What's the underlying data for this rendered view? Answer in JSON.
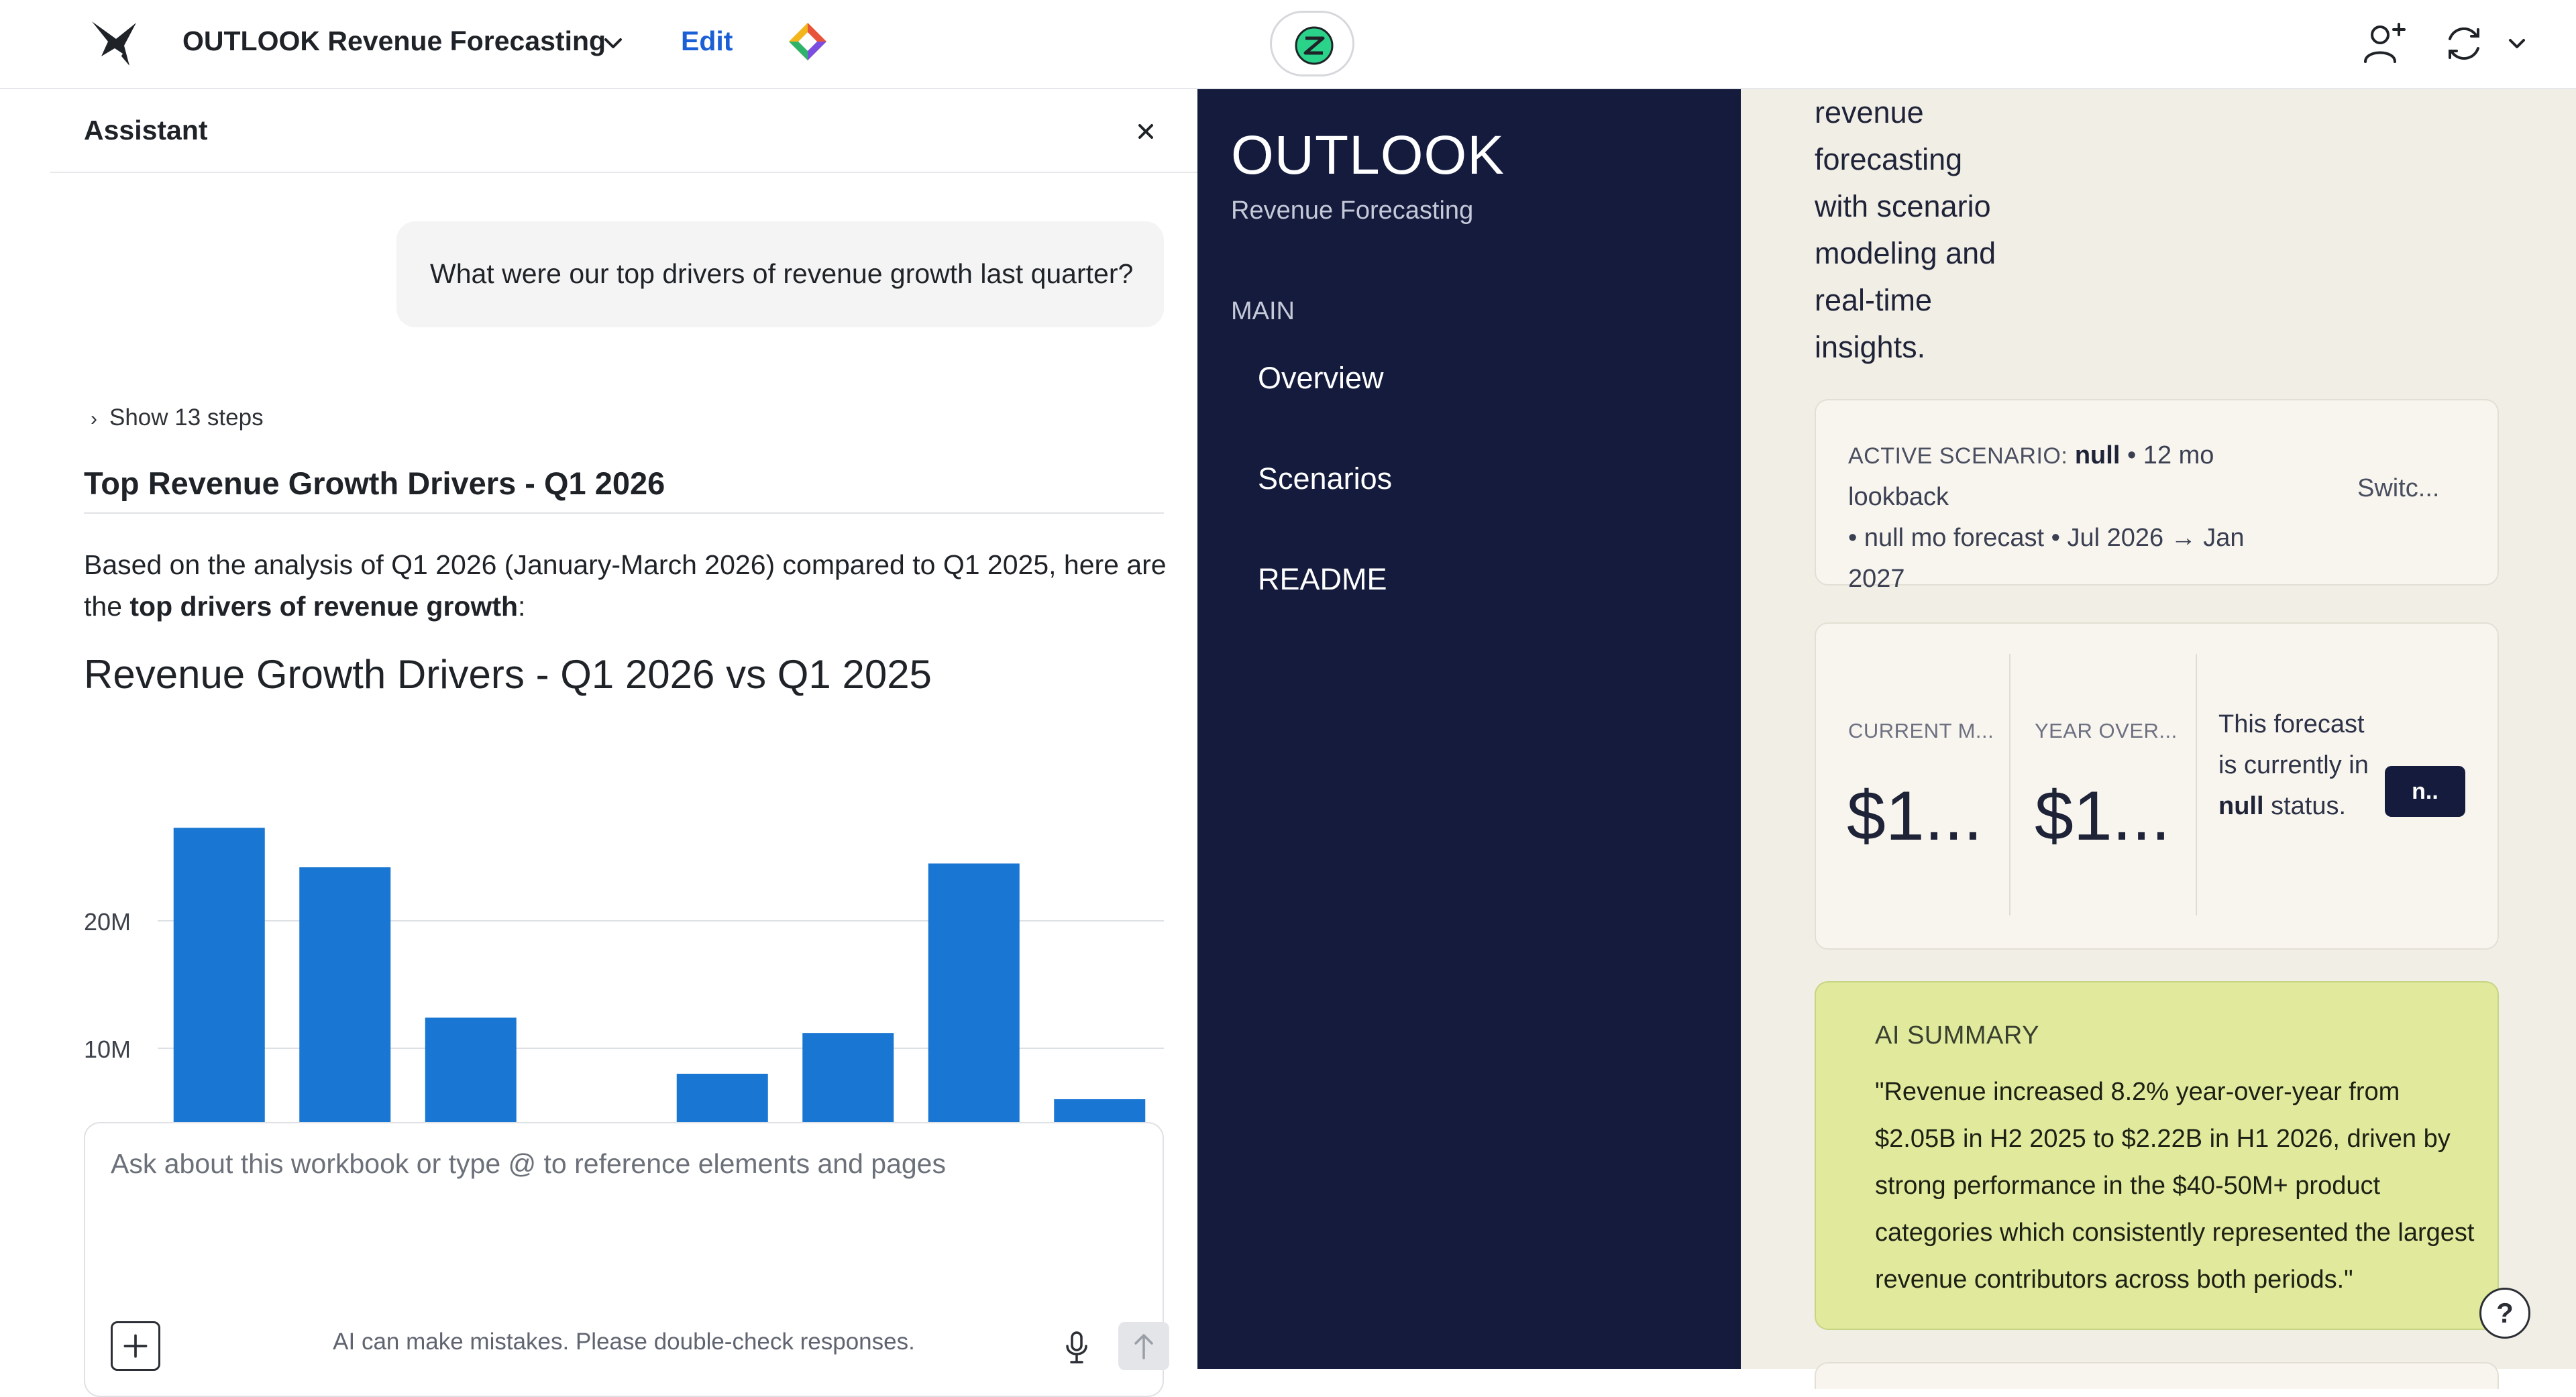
{
  "topbar": {
    "doc_title": "OUTLOOK Revenue Forecasting",
    "edit_label": "Edit"
  },
  "assistant": {
    "title": "Assistant",
    "close_label": "×",
    "user_message": "What were our top drivers of revenue growth last quarter?",
    "steps_toggle": "Show 13 steps",
    "response_heading": "Top Revenue Growth Drivers - Q1 2026",
    "response_text_before": "Based on the analysis of Q1 2026 (January-March 2026) compared to Q1 2025, here are the ",
    "response_text_bold": "top drivers of revenue growth",
    "response_text_after": ":",
    "composer_placeholder": "Ask about this workbook or type @ to reference elements and pages",
    "add_label": "+",
    "disclaimer": "AI can make mistakes. Please double-check responses."
  },
  "chart_data": {
    "type": "bar",
    "title": "Revenue Growth Drivers - Q1 2026 vs Q1 2025",
    "categories": [
      "",
      "",
      "",
      "",
      "",
      "",
      "",
      ""
    ],
    "values": [
      27300000,
      24200000,
      12400000,
      0,
      8000000,
      11200000,
      24500000,
      6000000
    ],
    "y_ticks": [
      "10M",
      "20M"
    ],
    "color": "#1976d2",
    "grid": true,
    "note_visible_range": "chart is clipped at the bottom by the composer; y-axis below 10M not visible"
  },
  "dashboard": {
    "brand_title": "OUTLOOK",
    "brand_subtitle": "Revenue Forecasting",
    "nav_section": "MAIN",
    "nav_items": [
      "Overview",
      "Scenarios",
      "README"
    ],
    "intro_lines": [
      "revenue",
      "forecasting",
      "with scenario",
      "modeling and",
      "real-time",
      "insights."
    ],
    "scenario": {
      "label": "ACTIVE SCENARIO:",
      "name": "null",
      "line1_rest": " • 12 mo lookback",
      "line2": "• null mo forecast • Jul 2026 → Jan",
      "line3": "2027",
      "switch_label": "Switc..."
    },
    "metrics": [
      {
        "label": "CURRENT M...",
        "value": "$1..."
      },
      {
        "label": "YEAR OVER...",
        "value": "$1..."
      }
    ],
    "status": {
      "text_before": "This forecast is currently in ",
      "status_value": "null",
      "text_after": " status.",
      "button_label": "n.."
    },
    "ai_summary": {
      "label": "AI SUMMARY",
      "text": "\"Revenue increased 8.2% year-over-year from $2.05B in H2 2025 to $2.22B in H1 2026, driven by strong performance in the $40-50M+ product categories which consistently represented the largest revenue contributors across both periods.\""
    },
    "help_label": "?"
  },
  "colors": {
    "nav_dark": "#141b3d",
    "content_bg": "#f1eee6",
    "ai_card": "#e1ea9c",
    "accent_link": "#1a5fd6",
    "bar": "#1976d2"
  }
}
